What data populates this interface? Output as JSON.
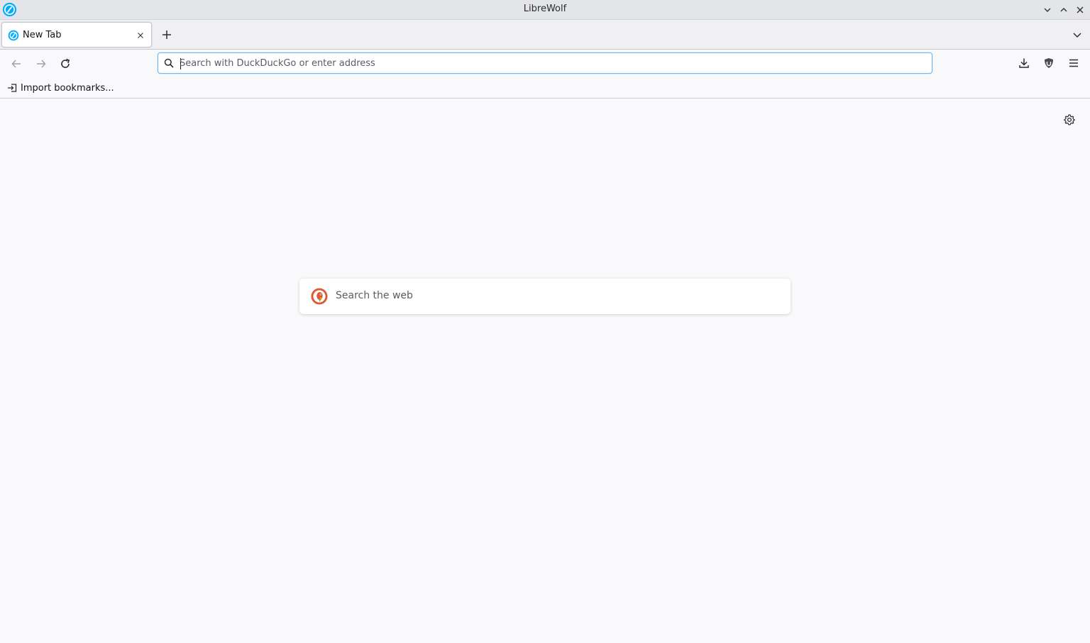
{
  "window": {
    "title": "LibreWolf",
    "controls": [
      "minimize",
      "maximize",
      "close"
    ]
  },
  "tabs": [
    {
      "label": "New Tab",
      "active": true,
      "favicon": "librewolf-icon"
    }
  ],
  "toolbar": {
    "urlbar": {
      "placeholder": "Search with DuckDuckGo or enter address",
      "value": ""
    },
    "buttons": [
      "back",
      "forward",
      "reload",
      "downloads",
      "ublock-origin",
      "app-menu"
    ]
  },
  "bookmarks_bar": {
    "import_label": "Import bookmarks..."
  },
  "content": {
    "search_placeholder": "Search the web",
    "search_engine_icon": "duckduckgo-icon"
  },
  "colors": {
    "accent": "#0a84ff",
    "urlbar_focus": "#7bb4e8",
    "background": "#f9f9fb",
    "titlebar": "#e3e5e8"
  }
}
